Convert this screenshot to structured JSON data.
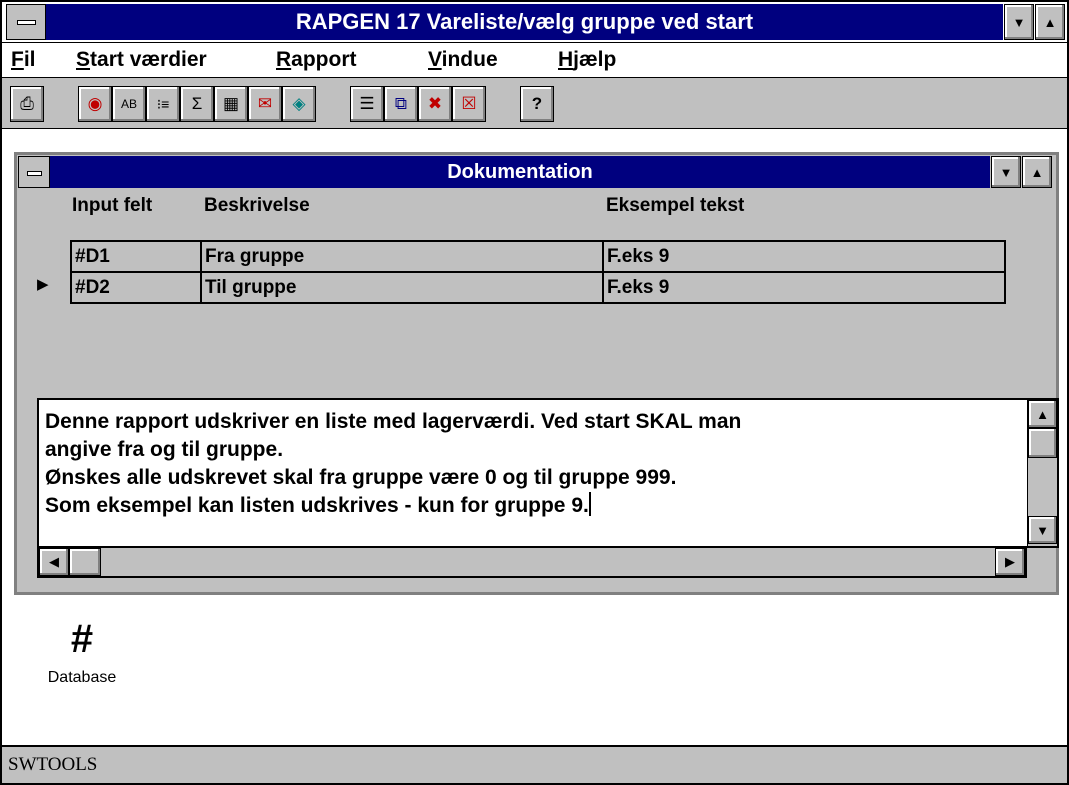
{
  "app": {
    "title": "RAPGEN 17 Vareliste/vælg gruppe ved start",
    "title_color": "#00007f"
  },
  "menu": {
    "items": [
      {
        "accel": "F",
        "rest": "il"
      },
      {
        "accel": "S",
        "rest": "tart værdier"
      },
      {
        "accel": "R",
        "rest": "apport"
      },
      {
        "accel": "V",
        "rest": "indue"
      },
      {
        "accel": "H",
        "rest": "jælp"
      }
    ]
  },
  "toolbar": {
    "icons": [
      "printer-icon",
      "target-icon",
      "ab-field-icon",
      "list-icon",
      "sum-icon",
      "calculator-icon",
      "chart-icon",
      "diamond-icon",
      "tile-icon",
      "cascade-icon",
      "close-windows-icon",
      "close-icon",
      "help-icon"
    ],
    "glyphs": [
      "⎙",
      "◉",
      "AB",
      "⁝≡",
      "Σ",
      "▦",
      "✉",
      "◈",
      "☰",
      "⧉",
      "✖",
      "☒",
      "?"
    ]
  },
  "doc_window": {
    "title": "Dokumentation",
    "columns": [
      "Input felt",
      "Beskrivelse",
      "Eksempel tekst"
    ],
    "rows": [
      {
        "field": "#D1",
        "desc": "Fra gruppe",
        "example": "F.eks 9"
      },
      {
        "field": "#D2",
        "desc": "Til gruppe",
        "example": "F.eks 9"
      }
    ],
    "current_row_marker": "▶",
    "memo_lines": [
      "Denne rapport udskriver en liste med lagerværdi. Ved start SKAL man",
      "angive fra og til gruppe.",
      "Ønskes alle udskrevet skal fra gruppe være 0 og til gruppe 999.",
      "Som eksempel kan listen udskrives - kun for gruppe 9."
    ]
  },
  "desktop_icon": {
    "glyph": "#",
    "label": "Database"
  },
  "statusbar": {
    "text": "SWTOOLS"
  }
}
